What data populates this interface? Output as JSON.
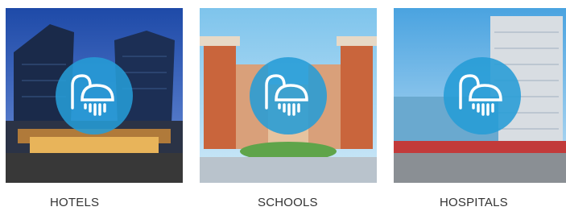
{
  "categories": [
    {
      "label": "HOTELS",
      "icon": "shower-logo-icon"
    },
    {
      "label": "SCHOOLS",
      "icon": "shower-logo-icon"
    },
    {
      "label": "HOSPITALS",
      "icon": "shower-logo-icon"
    }
  ],
  "colors": {
    "badge": "#269cd6",
    "caption": "#333333"
  }
}
